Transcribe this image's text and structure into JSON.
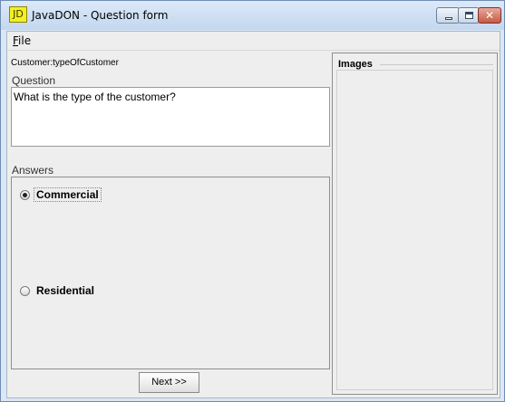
{
  "window": {
    "icon_text": "JD",
    "title": "JavaDON - Question form",
    "close_glyph": "✕"
  },
  "menu": {
    "file_mnemonic": "F",
    "file_rest": "ile"
  },
  "question": {
    "id": "Customer:typeOfCustomer",
    "label": "Question",
    "text": "What is the type of the customer?"
  },
  "answers": {
    "label": "Answers",
    "options": [
      {
        "label": "Commercial",
        "selected": true
      },
      {
        "label": "Residential",
        "selected": false
      }
    ]
  },
  "buttons": {
    "next": "Next >>"
  },
  "images": {
    "title": "Images"
  }
}
